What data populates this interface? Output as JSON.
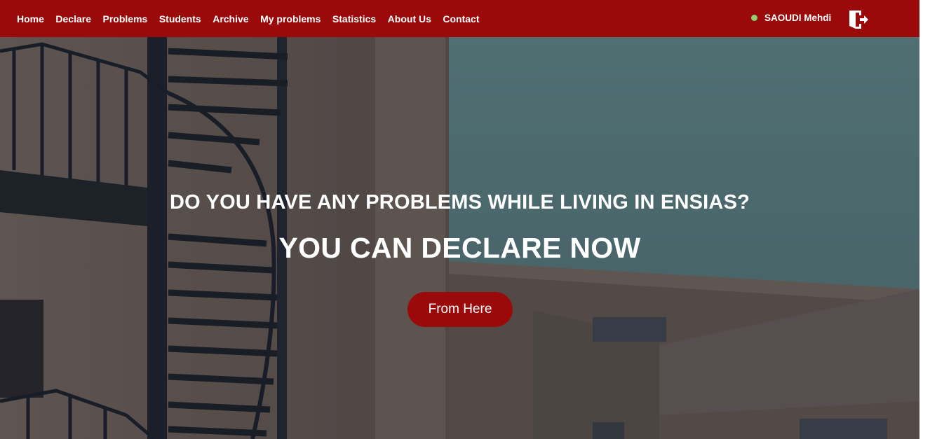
{
  "nav": {
    "items": [
      {
        "label": "Home"
      },
      {
        "label": "Declare"
      },
      {
        "label": "Problems"
      },
      {
        "label": "Students"
      },
      {
        "label": "Archive"
      },
      {
        "label": "My problems"
      },
      {
        "label": "Statistics"
      },
      {
        "label": "About Us"
      },
      {
        "label": "Contact"
      }
    ]
  },
  "user": {
    "name": "SAOUDI Mehdi",
    "status_color": "#8fd16e",
    "logout_icon": "logout-door-icon"
  },
  "hero": {
    "question": "DO YOU HAVE ANY PROBLEMS WHILE LIVING IN ENSIAS?",
    "cta": "YOU CAN DECLARE NOW",
    "button_label": "From Here",
    "background_image": "building-with-spiral-staircase"
  },
  "colors": {
    "brand": "#9b0a0a",
    "text_light": "#ffffff"
  }
}
